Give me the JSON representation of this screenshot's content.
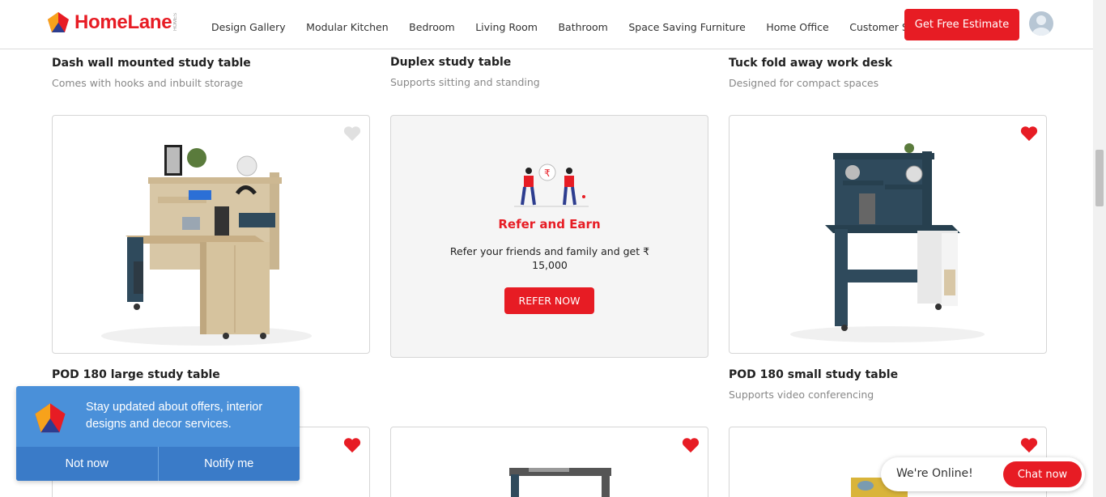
{
  "brand": {
    "name": "HomeLane",
    "accent": "#e71c24",
    "sup": "HOMES"
  },
  "nav": [
    "Design Gallery",
    "Modular Kitchen",
    "Bedroom",
    "Living Room",
    "Bathroom",
    "Space Saving Furniture",
    "Home Office",
    "Customer Stories"
  ],
  "header": {
    "cta_label": "Get Free Estimate",
    "avatar_icon": "user-avatar-icon"
  },
  "row1": [
    {
      "title": "Dash wall mounted study table",
      "subtitle": "Comes with hooks and inbuilt storage"
    },
    {
      "title": "Duplex study table",
      "subtitle": "Supports sitting and standing"
    },
    {
      "title": "Tuck fold away work desk",
      "subtitle": "Designed for compact spaces"
    }
  ],
  "row2": [
    {
      "title": "POD 180 large study table",
      "subtitle": "",
      "favorited": false
    },
    {
      "title": "POD 180 small study table",
      "subtitle": "Supports video conferencing",
      "favorited": true
    }
  ],
  "refer": {
    "title": "Refer and Earn",
    "text": "Refer your friends and family and get ₹ 15,000",
    "button": "REFER NOW",
    "icon": "rupee-icon"
  },
  "row3": [
    {
      "favorited": true
    },
    {
      "favorited": true
    },
    {
      "favorited": true
    }
  ],
  "notification": {
    "text": "Stay updated about offers, interior designs and decor services.",
    "decline": "Not now",
    "accept": "Notify me"
  },
  "chat": {
    "status": "We're Online!",
    "button": "Chat now"
  }
}
